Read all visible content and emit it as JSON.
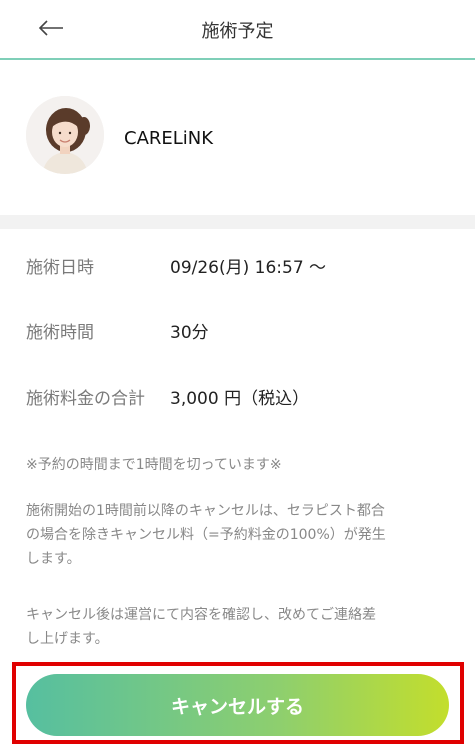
{
  "header": {
    "title": "施術予定",
    "back_icon": "arrow-left-icon"
  },
  "profile": {
    "name": "CARELiNK",
    "avatar_icon": "therapist-photo"
  },
  "details": [
    {
      "label": "施術日時",
      "value": "09/26(月) 16:57 〜"
    },
    {
      "label": "施術時間",
      "value": "30分"
    },
    {
      "label": "施術料金の合計",
      "value": "3,000 円（税込）"
    }
  ],
  "notes": {
    "warning": "※予約の時間まで1時間を切っています※",
    "policy_line1": "施術開始の1時間前以降のキャンセルは、セラピスト都合",
    "policy_line2": "の場合を除きキャンセル料（=予約料金の100%）が発生",
    "policy_line3": "します。",
    "confirm_line1": "キャンセル後は運営にて内容を確認し、改めてご連絡差",
    "confirm_line2": "し上げます。"
  },
  "actions": {
    "cancel_label": "キャンセルする"
  },
  "colors": {
    "accent_line": "#7fcfb8",
    "button_gradient_start": "#56bfa0",
    "button_gradient_end": "#c3de2c",
    "highlight_frame": "#e00000"
  }
}
